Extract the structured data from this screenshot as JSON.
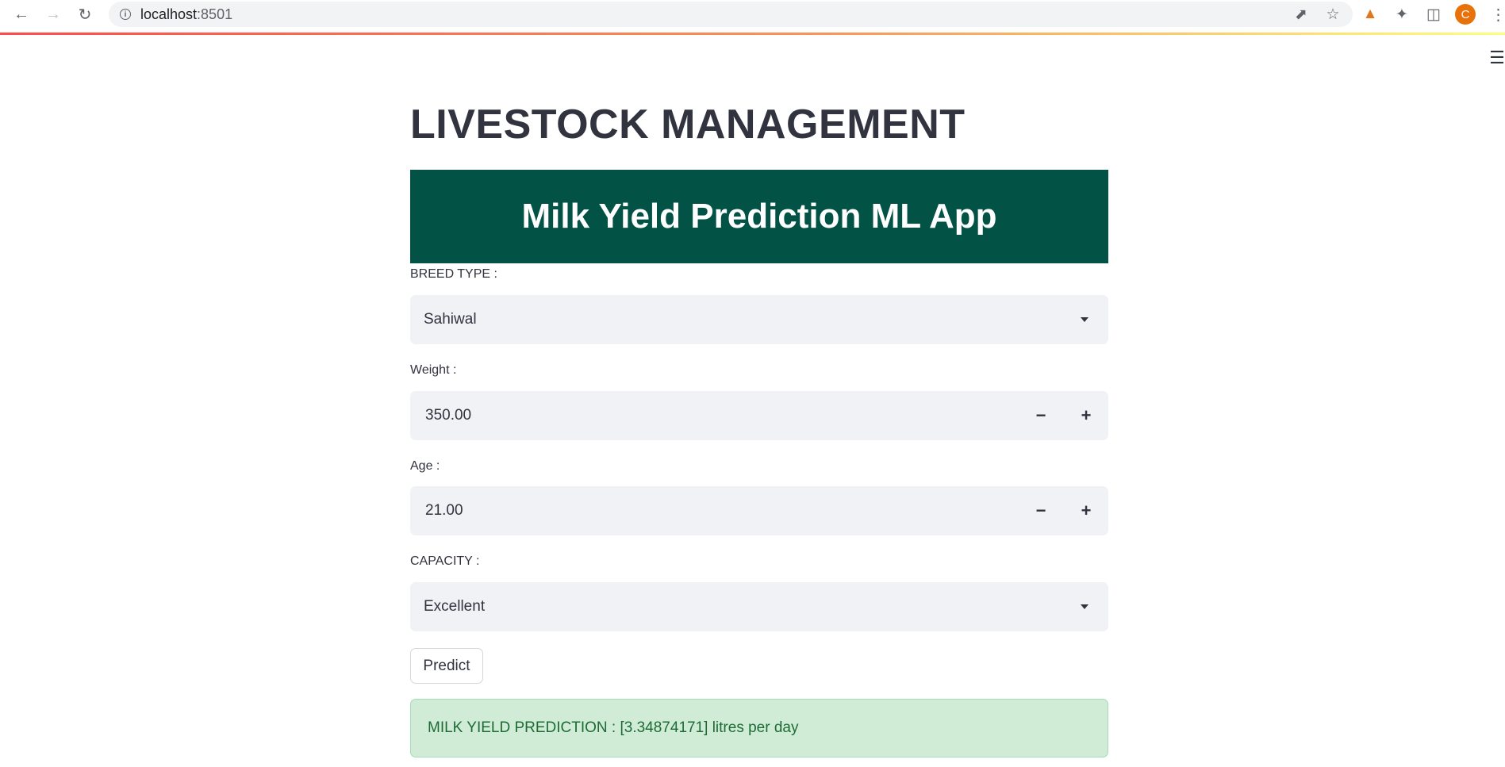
{
  "browser": {
    "url_host": "localhost",
    "url_port": ":8501",
    "icons": {
      "back": "arrow-left-icon",
      "forward": "arrow-right-icon",
      "reload": "reload-icon",
      "site_info": "info-icon",
      "share": "share-icon",
      "bookmark": "star-icon",
      "extension_fox": "metamask-fox-icon",
      "extensions": "puzzle-icon",
      "side_panel": "side-panel-icon",
      "menu": "three-dots-icon"
    },
    "profile_initial": "C",
    "profile_color": "#e8710a"
  },
  "app": {
    "menu_icon": "hamburger-icon",
    "title": "LIVESTOCK MANAGEMENT",
    "banner": {
      "text": "Milk Yield Prediction ML App",
      "background": "#025246"
    },
    "breed": {
      "label": "BREED TYPE :",
      "value": "Sahiwal"
    },
    "weight": {
      "label": "Weight :",
      "value": "350.00",
      "decrement": "−",
      "increment": "+"
    },
    "age": {
      "label": "Age :",
      "value": "21.00",
      "decrement": "−",
      "increment": "+"
    },
    "capacity": {
      "label": "CAPACITY :",
      "value": "Excellent"
    },
    "predict_button": "Predict",
    "result": {
      "text": "MILK YIELD PREDICTION : [3.34874171] litres per day",
      "background": "#d0ecd7",
      "text_color": "#1d6b34"
    }
  }
}
